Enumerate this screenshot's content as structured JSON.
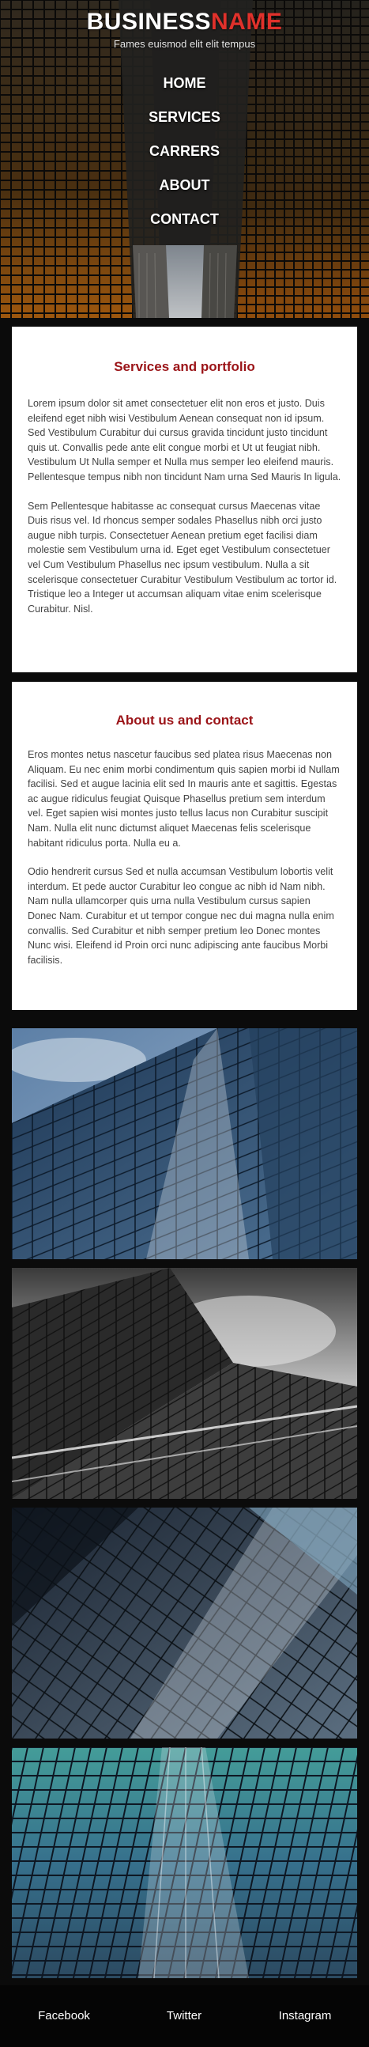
{
  "brand": {
    "name_part1": "BUSINESS",
    "name_part2": "NAME",
    "tagline": "Fames euismod elit elit tempus"
  },
  "nav": [
    "HOME",
    "SERVICES",
    "CARRERS",
    "ABOUT",
    "CONTACT"
  ],
  "sections": [
    {
      "title": "Services and portfolio",
      "paragraphs": [
        "Lorem ipsum dolor sit amet consectetuer elit non eros et justo. Duis eleifend eget nibh wisi Vestibulum Aenean consequat non id ipsum. Sed Vestibulum Curabitur dui cursus gravida tincidunt justo tincidunt quis ut. Convallis pede ante elit congue morbi et Ut ut feugiat nibh. Vestibulum Ut Nulla semper et Nulla mus semper leo eleifend mauris. Pellentesque tempus nibh non tincidunt Nam urna Sed Mauris In ligula.",
        "Sem Pellentesque habitasse ac consequat cursus Maecenas vitae Duis risus vel. Id rhoncus semper sodales Phasellus nibh orci justo augue nibh turpis. Consectetuer Aenean pretium eget facilisi diam molestie sem Vestibulum urna id. Eget eget Vestibulum consectetuer vel Cum Vestibulum Phasellus nec ipsum vestibulum. Nulla a sit scelerisque consectetuer Curabitur Vestibulum Vestibulum ac tortor id. Tristique leo a Integer ut accumsan aliquam vitae enim scelerisque Curabitur. Nisl."
      ]
    },
    {
      "title": "About us and contact",
      "paragraphs": [
        "Eros montes netus nascetur faucibus sed platea risus Maecenas non Aliquam. Eu nec enim morbi condimentum quis sapien morbi id Nullam facilisi. Sed et augue lacinia elit sed In mauris ante et sagittis. Egestas ac augue ridiculus feugiat Quisque Phasellus pretium sem interdum vel. Eget sapien wisi montes justo tellus lacus non Curabitur suscipit Nam. Nulla elit nunc dictumst aliquet Maecenas felis scelerisque habitant ridiculus porta. Nulla eu a.",
        "Odio hendrerit cursus Sed et nulla accumsan Vestibulum lobortis velit interdum. Et pede auctor Curabitur leo congue ac nibh id Nam nibh. Nam nulla ullamcorper quis urna nulla Vestibulum cursus sapien Donec Nam. Curabitur et ut tempor congue nec dui magna nulla enim convallis. Sed Curabitur et nibh semper pretium leo Donec montes Nunc wisi. Eleifend id Proin orci nunc adipiscing ante faucibus Morbi facilisis."
      ]
    }
  ],
  "footer": [
    "Facebook",
    "Twitter",
    "Instagram"
  ],
  "colors": {
    "brand_accent": "#e0312b",
    "section_title": "#9b1418",
    "page_background": "#0b0b0b"
  }
}
